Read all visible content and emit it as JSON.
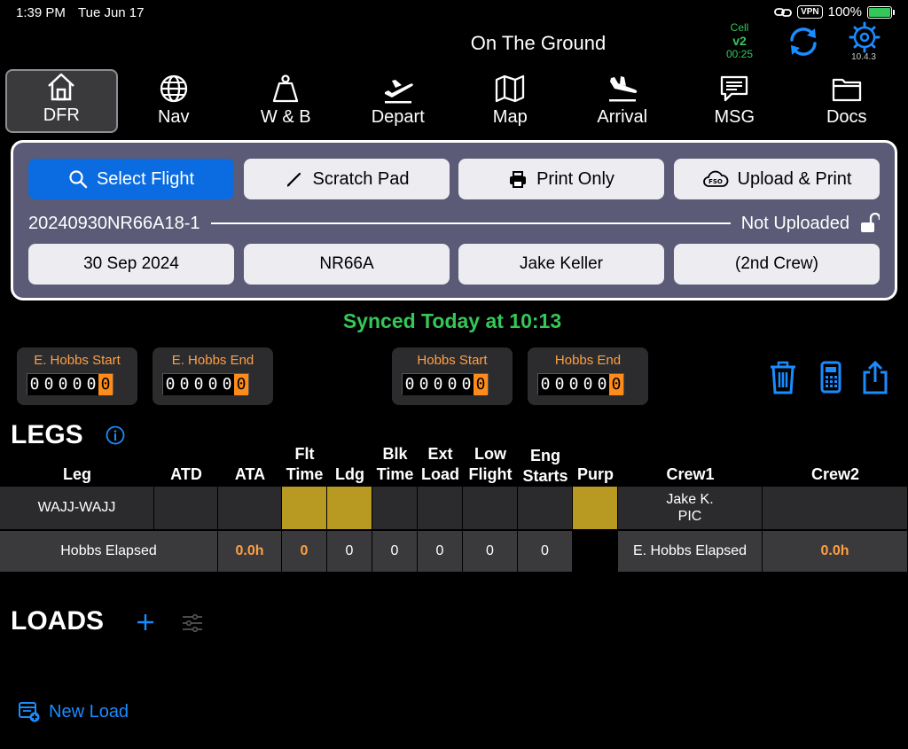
{
  "status": {
    "time": "1:39 PM",
    "date": "Tue Jun 17",
    "vpn": "VPN",
    "battery": "100%"
  },
  "header": {
    "title": "On The Ground",
    "cell_label": "Cell",
    "cell_version": "v2",
    "cell_time": "00:25",
    "app_version": "10.4.3"
  },
  "tabs": [
    {
      "label": "DFR",
      "icon": "home-icon"
    },
    {
      "label": "Nav",
      "icon": "globe-icon"
    },
    {
      "label": "W & B",
      "icon": "weight-icon"
    },
    {
      "label": "Depart",
      "icon": "plane-depart-icon"
    },
    {
      "label": "Map",
      "icon": "map-icon"
    },
    {
      "label": "Arrival",
      "icon": "plane-arrival-icon"
    },
    {
      "label": "MSG",
      "icon": "message-icon"
    },
    {
      "label": "Docs",
      "icon": "folder-icon"
    }
  ],
  "flight": {
    "select_label": "Select Flight",
    "scratch_label": "Scratch Pad",
    "print_label": "Print Only",
    "upload_label": "Upload & Print",
    "id": "20240930NR66A18-1",
    "upload_status": "Not Uploaded",
    "date": "30 Sep 2024",
    "aircraft": "NR66A",
    "pilot": "Jake Keller",
    "second_crew": "(2nd Crew)"
  },
  "synced": "Synced Today at 10:13",
  "hobbs": [
    {
      "label": "E. Hobbs Start",
      "digits": [
        "0",
        "0",
        "0",
        "0",
        "0",
        "0"
      ]
    },
    {
      "label": "E. Hobbs End",
      "digits": [
        "0",
        "0",
        "0",
        "0",
        "0",
        "0"
      ]
    },
    {
      "label": "Hobbs Start",
      "digits": [
        "0",
        "0",
        "0",
        "0",
        "0",
        "0"
      ]
    },
    {
      "label": "Hobbs End",
      "digits": [
        "0",
        "0",
        "0",
        "0",
        "0",
        "0"
      ]
    }
  ],
  "legs": {
    "title": "LEGS",
    "headers": {
      "leg": "Leg",
      "atd": "ATD",
      "ata": "ATA",
      "flt1": "Flt",
      "flt2": "Time",
      "ldg": "Ldg",
      "blk1": "Blk",
      "blk2": "Time",
      "ext1": "Ext",
      "ext2": "Load",
      "low1": "Low",
      "low2": "Flight",
      "eng1": "Eng",
      "eng2": "Starts",
      "purp": "Purp",
      "crew1": "Crew1",
      "crew2": "Crew2"
    },
    "row": {
      "leg": "WAJJ-WAJJ",
      "crew1_name": "Jake K.",
      "crew1_role": "PIC"
    },
    "totals": {
      "hobbs_label": "Hobbs Elapsed",
      "hobbs_value": "0.0h",
      "flt": "0",
      "ldg": "0",
      "blk": "0",
      "ext": "0",
      "low": "0",
      "eng": "0",
      "ehobbs_label": "E. Hobbs Elapsed",
      "ehobbs_value": "0.0h"
    }
  },
  "loads": {
    "title": "LOADS",
    "new_label": "New Load"
  },
  "colors": {
    "accent": "#0a6ce0",
    "sync_green": "#34c759",
    "hobbs_orange": "#ff9f43",
    "gold": "#b89922"
  }
}
